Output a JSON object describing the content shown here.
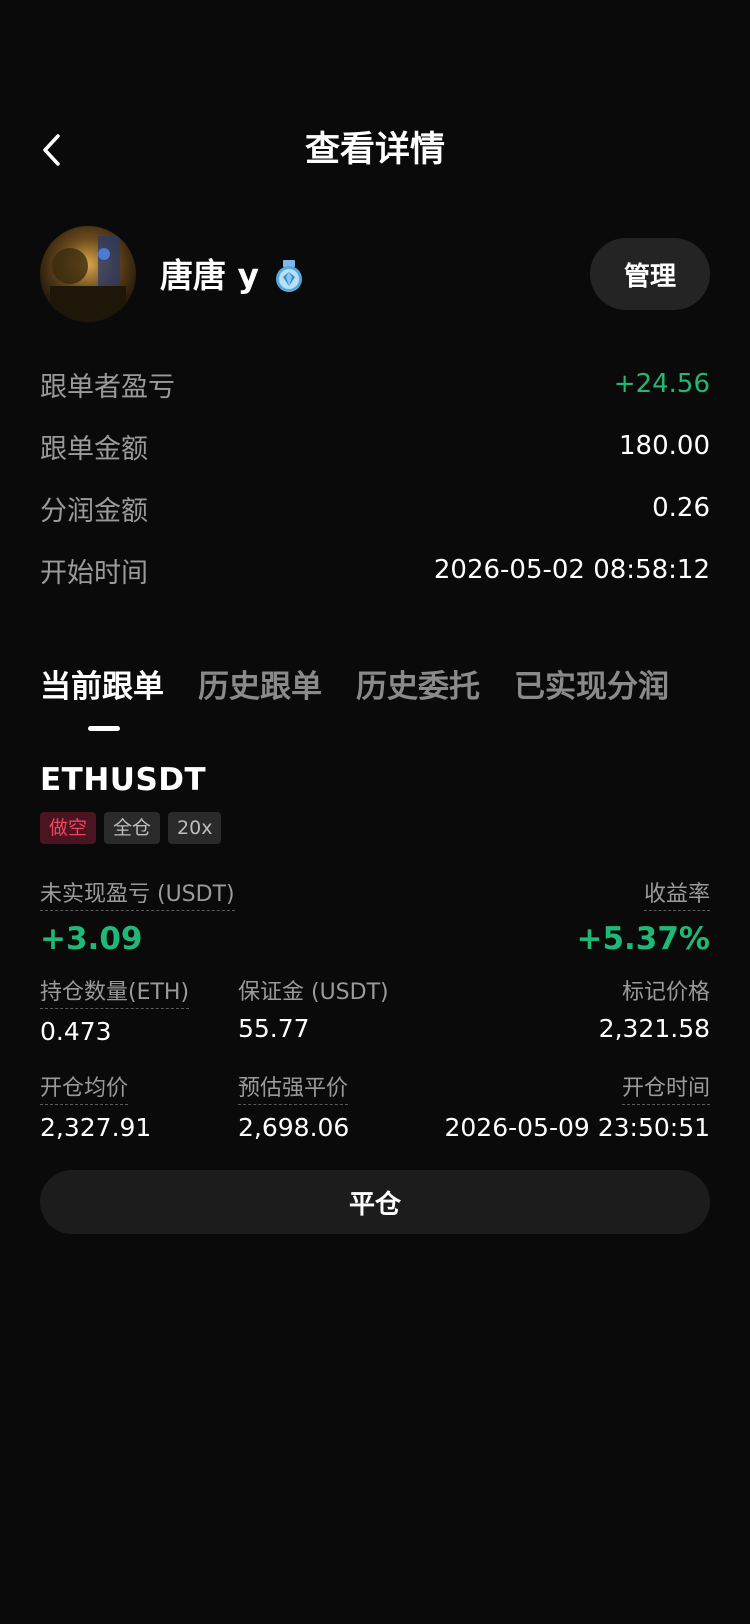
{
  "header": {
    "title": "查看详情"
  },
  "profile": {
    "username": "唐唐 y",
    "manage_label": "管理"
  },
  "info": {
    "rows": [
      {
        "label": "跟单者盈亏",
        "value": "+24.56",
        "positive": true
      },
      {
        "label": "跟单金额",
        "value": "180.00"
      },
      {
        "label": "分润金额",
        "value": "0.26"
      },
      {
        "label": "开始时间",
        "value": "2026-05-02 08:58:12"
      }
    ]
  },
  "tabs": [
    {
      "label": "当前跟单",
      "active": true
    },
    {
      "label": "历史跟单"
    },
    {
      "label": "历史委托"
    },
    {
      "label": "已实现分润"
    }
  ],
  "position": {
    "symbol": "ETHUSDT",
    "tags": {
      "side": "做空",
      "margin_mode": "全仓",
      "leverage": "20x"
    },
    "unrealized_pnl": {
      "label": "未实现盈亏 (USDT)",
      "value": "+3.09"
    },
    "roi": {
      "label": "收益率",
      "value": "+5.37%"
    },
    "quantity": {
      "label": "持仓数量(ETH)",
      "value": "0.473"
    },
    "margin": {
      "label": "保证金 (USDT)",
      "value": "55.77"
    },
    "mark_price": {
      "label": "标记价格",
      "value": "2,321.58"
    },
    "entry_price": {
      "label": "开仓均价",
      "value": "2,327.91"
    },
    "liq_price": {
      "label": "预估强平价",
      "value": "2,698.06"
    },
    "open_time": {
      "label": "开仓时间",
      "value": "2026-05-09 23:50:51"
    },
    "close_label": "平仓"
  },
  "colors": {
    "background": "#0a0a0a",
    "positive": "#1fb877",
    "short_tag": "#f0455f",
    "muted_text": "#9a9a9a"
  }
}
